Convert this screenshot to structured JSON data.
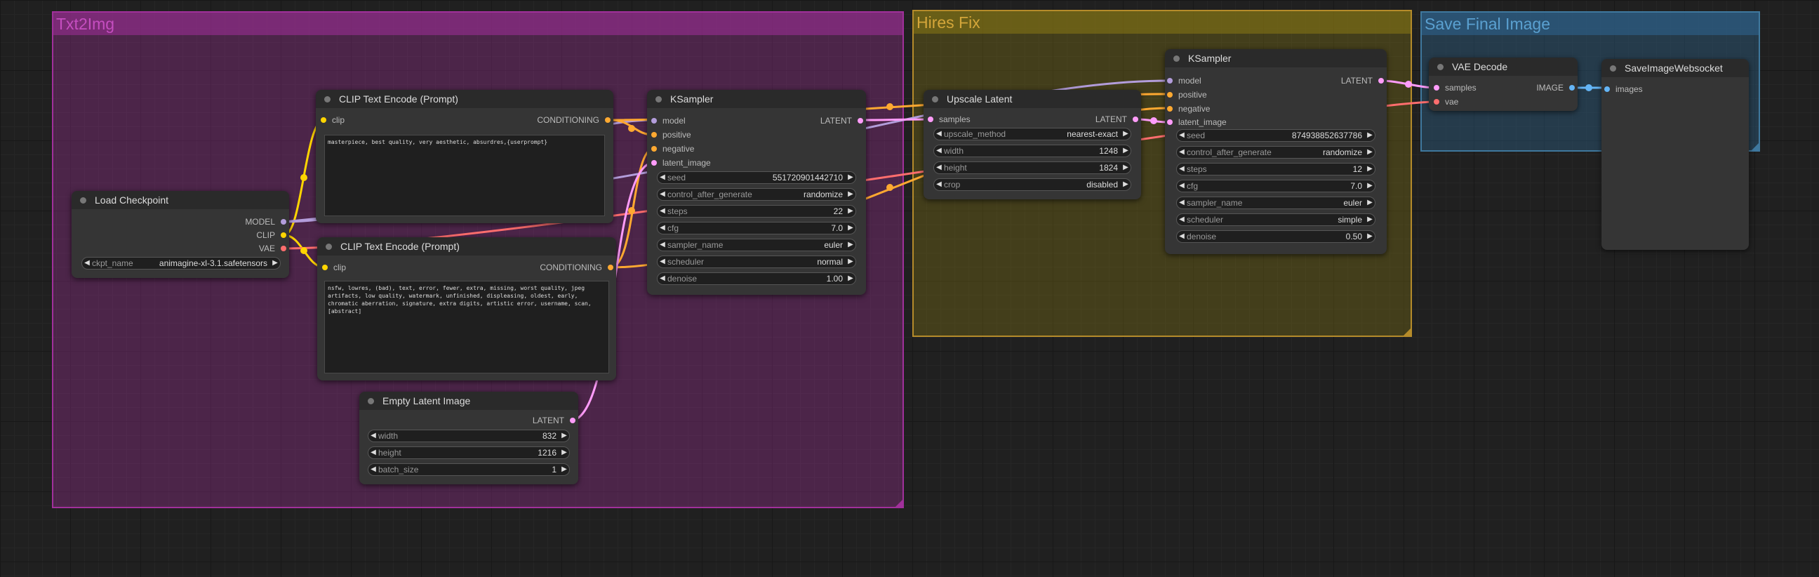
{
  "colors": {
    "model": "#b39ddb",
    "clip": "#ffd500",
    "vae": "#ff6e6e",
    "conditioning": "#ffa931",
    "latent": "#ff9cf9",
    "image": "#64b5f6"
  },
  "groups": {
    "txt2img": "Txt2Img",
    "hires_fix": "Hires Fix",
    "save_final": "Save Final Image"
  },
  "load_checkpoint": {
    "title": "Load Checkpoint",
    "outputs": [
      "MODEL",
      "CLIP",
      "VAE"
    ],
    "ckpt_label": "ckpt_name",
    "ckpt_value": "animagine-xl-3.1.safetensors"
  },
  "clip_pos": {
    "title": "CLIP Text Encode (Prompt)",
    "input": "clip",
    "output": "CONDITIONING",
    "text": "masterpiece, best quality, very aesthetic, absurdres,{userprompt}"
  },
  "clip_neg": {
    "title": "CLIP Text Encode (Prompt)",
    "input": "clip",
    "output": "CONDITIONING",
    "text": "nsfw, lowres, (bad), text, error, fewer, extra, missing, worst quality, jpeg artifacts, low quality, watermark, unfinished, displeasing, oldest, early, chromatic aberration, signature, extra digits, artistic error, username, scan, [abstract]"
  },
  "empty_latent": {
    "title": "Empty Latent Image",
    "output": "LATENT",
    "widgets": [
      {
        "label": "width",
        "value": "832"
      },
      {
        "label": "height",
        "value": "1216"
      },
      {
        "label": "batch_size",
        "value": "1"
      }
    ]
  },
  "ksampler1": {
    "title": "KSampler",
    "inputs": [
      "model",
      "positive",
      "negative",
      "latent_image"
    ],
    "output": "LATENT",
    "widgets": [
      {
        "label": "seed",
        "value": "551720901442710"
      },
      {
        "label": "control_after_generate",
        "value": "randomize"
      },
      {
        "label": "steps",
        "value": "22"
      },
      {
        "label": "cfg",
        "value": "7.0"
      },
      {
        "label": "sampler_name",
        "value": "euler"
      },
      {
        "label": "scheduler",
        "value": "normal"
      },
      {
        "label": "denoise",
        "value": "1.00"
      }
    ]
  },
  "upscale": {
    "title": "Upscale Latent",
    "input": "samples",
    "output": "LATENT",
    "widgets": [
      {
        "label": "upscale_method",
        "value": "nearest-exact"
      },
      {
        "label": "width",
        "value": "1248"
      },
      {
        "label": "height",
        "value": "1824"
      },
      {
        "label": "crop",
        "value": "disabled"
      }
    ]
  },
  "ksampler2": {
    "title": "KSampler",
    "inputs": [
      "model",
      "positive",
      "negative",
      "latent_image"
    ],
    "output": "LATENT",
    "widgets": [
      {
        "label": "seed",
        "value": "874938852637786"
      },
      {
        "label": "control_after_generate",
        "value": "randomize"
      },
      {
        "label": "steps",
        "value": "12"
      },
      {
        "label": "cfg",
        "value": "7.0"
      },
      {
        "label": "sampler_name",
        "value": "euler"
      },
      {
        "label": "scheduler",
        "value": "simple"
      },
      {
        "label": "denoise",
        "value": "0.50"
      }
    ]
  },
  "vae_decode": {
    "title": "VAE Decode",
    "inputs": [
      "samples",
      "vae"
    ],
    "output": "IMAGE"
  },
  "save_ws": {
    "title": "SaveImageWebsocket",
    "input": "images"
  }
}
